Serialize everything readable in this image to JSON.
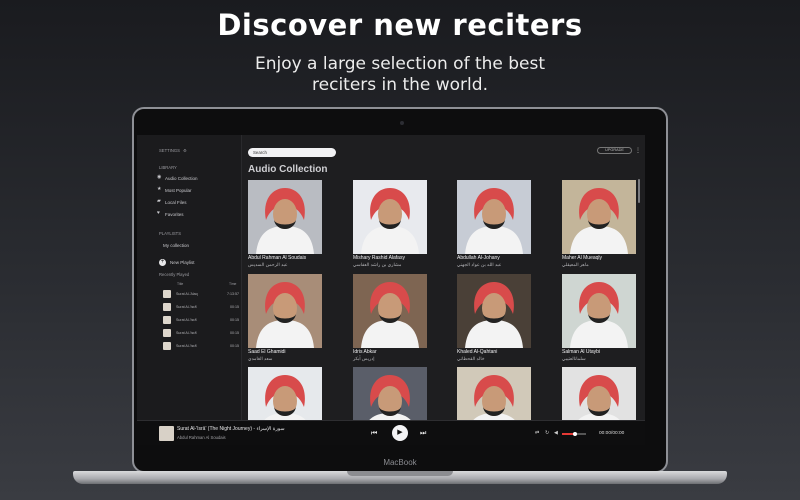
{
  "hero": {
    "title": "Discover new reciters",
    "subtitle": "Enjoy a large selection of the best reciters in the world."
  },
  "laptop": {
    "brand": "MacBook"
  },
  "sidebar": {
    "settings_label": "SETTINGS",
    "library_header": "LIBRARY",
    "library_items": [
      {
        "label": "Audio Collection",
        "icon": "disc-icon"
      },
      {
        "label": "Most Popular",
        "icon": "star-icon"
      },
      {
        "label": "Local Files",
        "icon": "folder-icon"
      },
      {
        "label": "Favorites",
        "icon": "heart-icon"
      }
    ],
    "playlists_header": "PLAYLISTS",
    "playlist_items": [
      "My collection"
    ],
    "new_playlist_label": "New Playlist",
    "recent_header": "Recently Played",
    "recent_col_title": "Title",
    "recent_col_time": "Time",
    "recent_items": [
      {
        "title": "Surat Al-'Alaq",
        "duration": "7:13:57"
      },
      {
        "title": "Surat Al-'Isrā'",
        "duration": "00:15"
      },
      {
        "title": "Surat Al-'Isrā'",
        "duration": "00:15"
      },
      {
        "title": "Surat Al-'Isrā'",
        "duration": "00:15"
      },
      {
        "title": "Surat Al-'Isrā'",
        "duration": "00:15"
      }
    ]
  },
  "topbar": {
    "search_placeholder": "Search",
    "upgrade_label": "UPGRADE"
  },
  "main": {
    "section_title": "Audio Collection",
    "reciters": [
      {
        "name": "Abdul Rahman Al Soudais",
        "arabic": "عبد الرحمن السديس",
        "bg": "#b9bcc2"
      },
      {
        "name": "Mishary Rashid Alafasy",
        "arabic": "مشاري بن راشد العفاسي",
        "bg": "#e8eaee"
      },
      {
        "name": "Abdullah Al-Johany",
        "arabic": "عبد الله بن عواد الجهني",
        "bg": "#c7ccd5"
      },
      {
        "name": "Maher Al Mueaqly",
        "arabic": "ماهر المعيقلي",
        "bg": "#c3b59a"
      },
      {
        "name": "Saad El Ghamidi",
        "arabic": "سعد الغامدي",
        "bg": "#a88d78"
      },
      {
        "name": "Idris Abkar",
        "arabic": "إدريس أبكر",
        "bg": "#7e6552"
      },
      {
        "name": "Khaled Al-Qahtani",
        "arabic": "خالد القحطاني",
        "bg": "#4a4037"
      },
      {
        "name": "Salman Al Utaybi",
        "arabic": "سلمانالعتيبي",
        "bg": "#cfd6d2"
      },
      {
        "name": "",
        "arabic": "",
        "bg": "#e6e9ec"
      },
      {
        "name": "",
        "arabic": "",
        "bg": "#5a5e69"
      },
      {
        "name": "",
        "arabic": "",
        "bg": "#d1c9b9"
      },
      {
        "name": "",
        "arabic": "",
        "bg": "#e2e2e2"
      }
    ]
  },
  "player": {
    "track_title": "Surat Al-'Isrā' (The Night Journey) - سورة الإسراء",
    "artist": "Abdul Rahman Al Soudais",
    "time": "00:00/00:00",
    "progress_fraction": 0.55,
    "accent": "#e53935"
  }
}
